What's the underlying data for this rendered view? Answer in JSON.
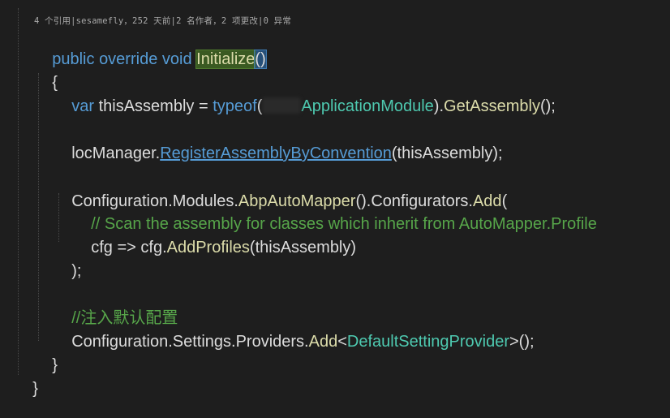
{
  "codelens": "4 个引用|sesamefly，252 天前|2 名作者，2 项更改|0 异常",
  "code": {
    "l1_public": "public",
    "l1_override": "override",
    "l1_void": "void",
    "l1_name": "Initialize",
    "l1_paren": "()",
    "l2_brace_open": "{",
    "l3_var": "var",
    "l3_ident": "thisAssembly",
    "l3_eq": " = ",
    "l3_typeof": "typeof",
    "l3_open": "(",
    "l3_type": "ApplicationModule",
    "l3_close": ").",
    "l3_method": "GetAssembly",
    "l3_end": "();",
    "l4_obj": "locManager.",
    "l4_method": "RegisterAssemblyByConvention",
    "l4_args": "(thisAssembly);",
    "l5_a": "Configuration.Modules.",
    "l5_m1": "AbpAutoMapper",
    "l5_b": "().Configurators.",
    "l5_m2": "Add",
    "l5_c": "(",
    "l6_comment": "// Scan the assembly for classes which inherit from AutoMapper.Profile",
    "l7_a": "cfg => cfg.",
    "l7_method": "AddProfiles",
    "l7_b": "(thisAssembly)",
    "l8_end": ");",
    "l9_comment": "//注入默认配置",
    "l10_a": "Configuration.Settings.Providers.",
    "l10_method": "Add",
    "l10_lt": "<",
    "l10_type": "DefaultSettingProvider",
    "l10_end": ">();",
    "l11_brace_close": "}",
    "l12_brace_close": "}"
  },
  "colors": {
    "background": "#1e1e1e",
    "keyword": "#569cd6",
    "type": "#4ec9b0",
    "method": "#dcdcaa",
    "comment": "#57a64a",
    "text": "#dcdcdc"
  }
}
